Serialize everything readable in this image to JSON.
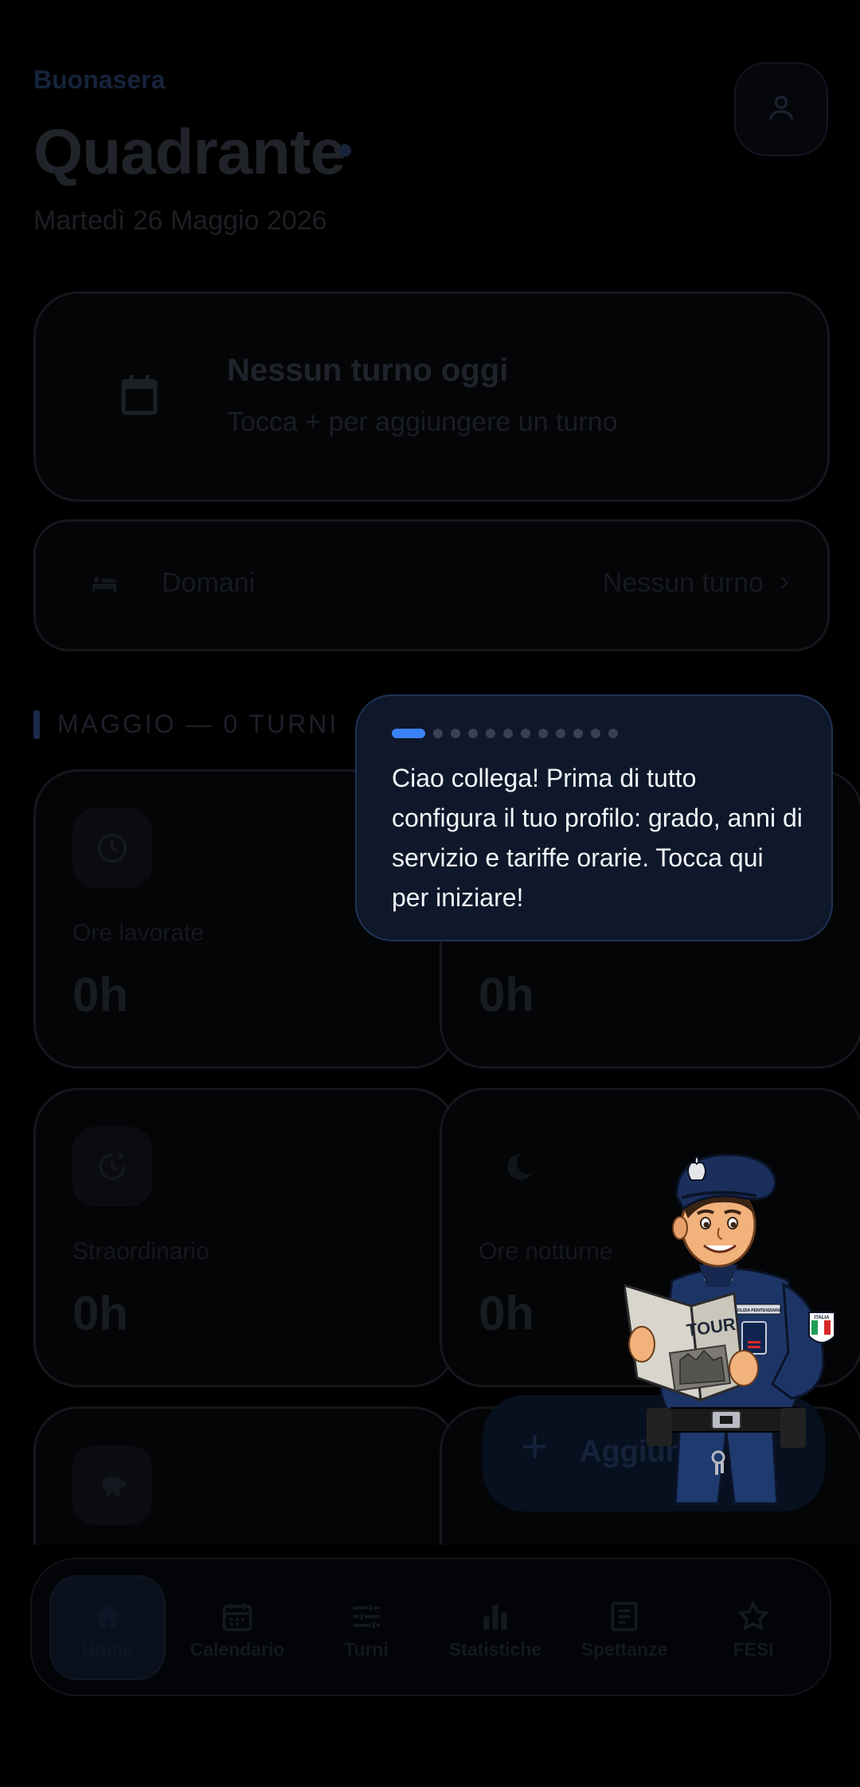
{
  "header": {
    "greeting": "Buonasera",
    "title": "Quadrante",
    "date": "Martedì 26 Maggio 2026"
  },
  "today": {
    "title": "Nessun turno oggi",
    "subtitle": "Tocca + per aggiungere un turno"
  },
  "tomorrow": {
    "label": "Domani",
    "value": "Nessun turno",
    "chevron": "›"
  },
  "month_header": "MAGGIO — 0 TURNI",
  "stats": [
    {
      "label": "Ore lavorate",
      "value": "0h",
      "icon": "clock-icon"
    },
    {
      "label": "",
      "value": "0h",
      "icon": ""
    },
    {
      "label": "Straordinario",
      "value": "0h",
      "icon": "overtime-icon"
    },
    {
      "label": "Ore notturne",
      "value": "0h",
      "icon": "moon-icon"
    },
    {
      "label": "",
      "value": "",
      "icon": "piggy-bank-icon"
    },
    {
      "label": "",
      "value": "",
      "icon": ""
    }
  ],
  "fab": {
    "plus": "+",
    "label": "Aggiun"
  },
  "nav": {
    "items": [
      {
        "label": "Home",
        "icon": "home-icon",
        "active": true
      },
      {
        "label": "Calendario",
        "icon": "calendar-icon",
        "active": false
      },
      {
        "label": "Turni",
        "icon": "sliders-icon",
        "active": false
      },
      {
        "label": "Statistiche",
        "icon": "bar-chart-icon",
        "active": false
      },
      {
        "label": "Spettanze",
        "icon": "receipt-icon",
        "active": false
      },
      {
        "label": "FESI",
        "icon": "star-icon",
        "active": false
      }
    ]
  },
  "tour": {
    "step": 1,
    "total_steps": 12,
    "message": "Ciao collega! Prima di tutto configura il tuo profilo: grado, anni di servizio e tariffe orarie. Tocca qui per iniziare!",
    "mascot_book_text": "TOUR",
    "mascot_badge_text": "POLIZIA PENITENZIARIA",
    "mascot_patch_text": "ITALIA"
  },
  "colors": {
    "background": "#000000",
    "tooltip_bg": "#0f172a",
    "accent": "#3b82f6",
    "tooltip_text": "#f1f5f9"
  }
}
